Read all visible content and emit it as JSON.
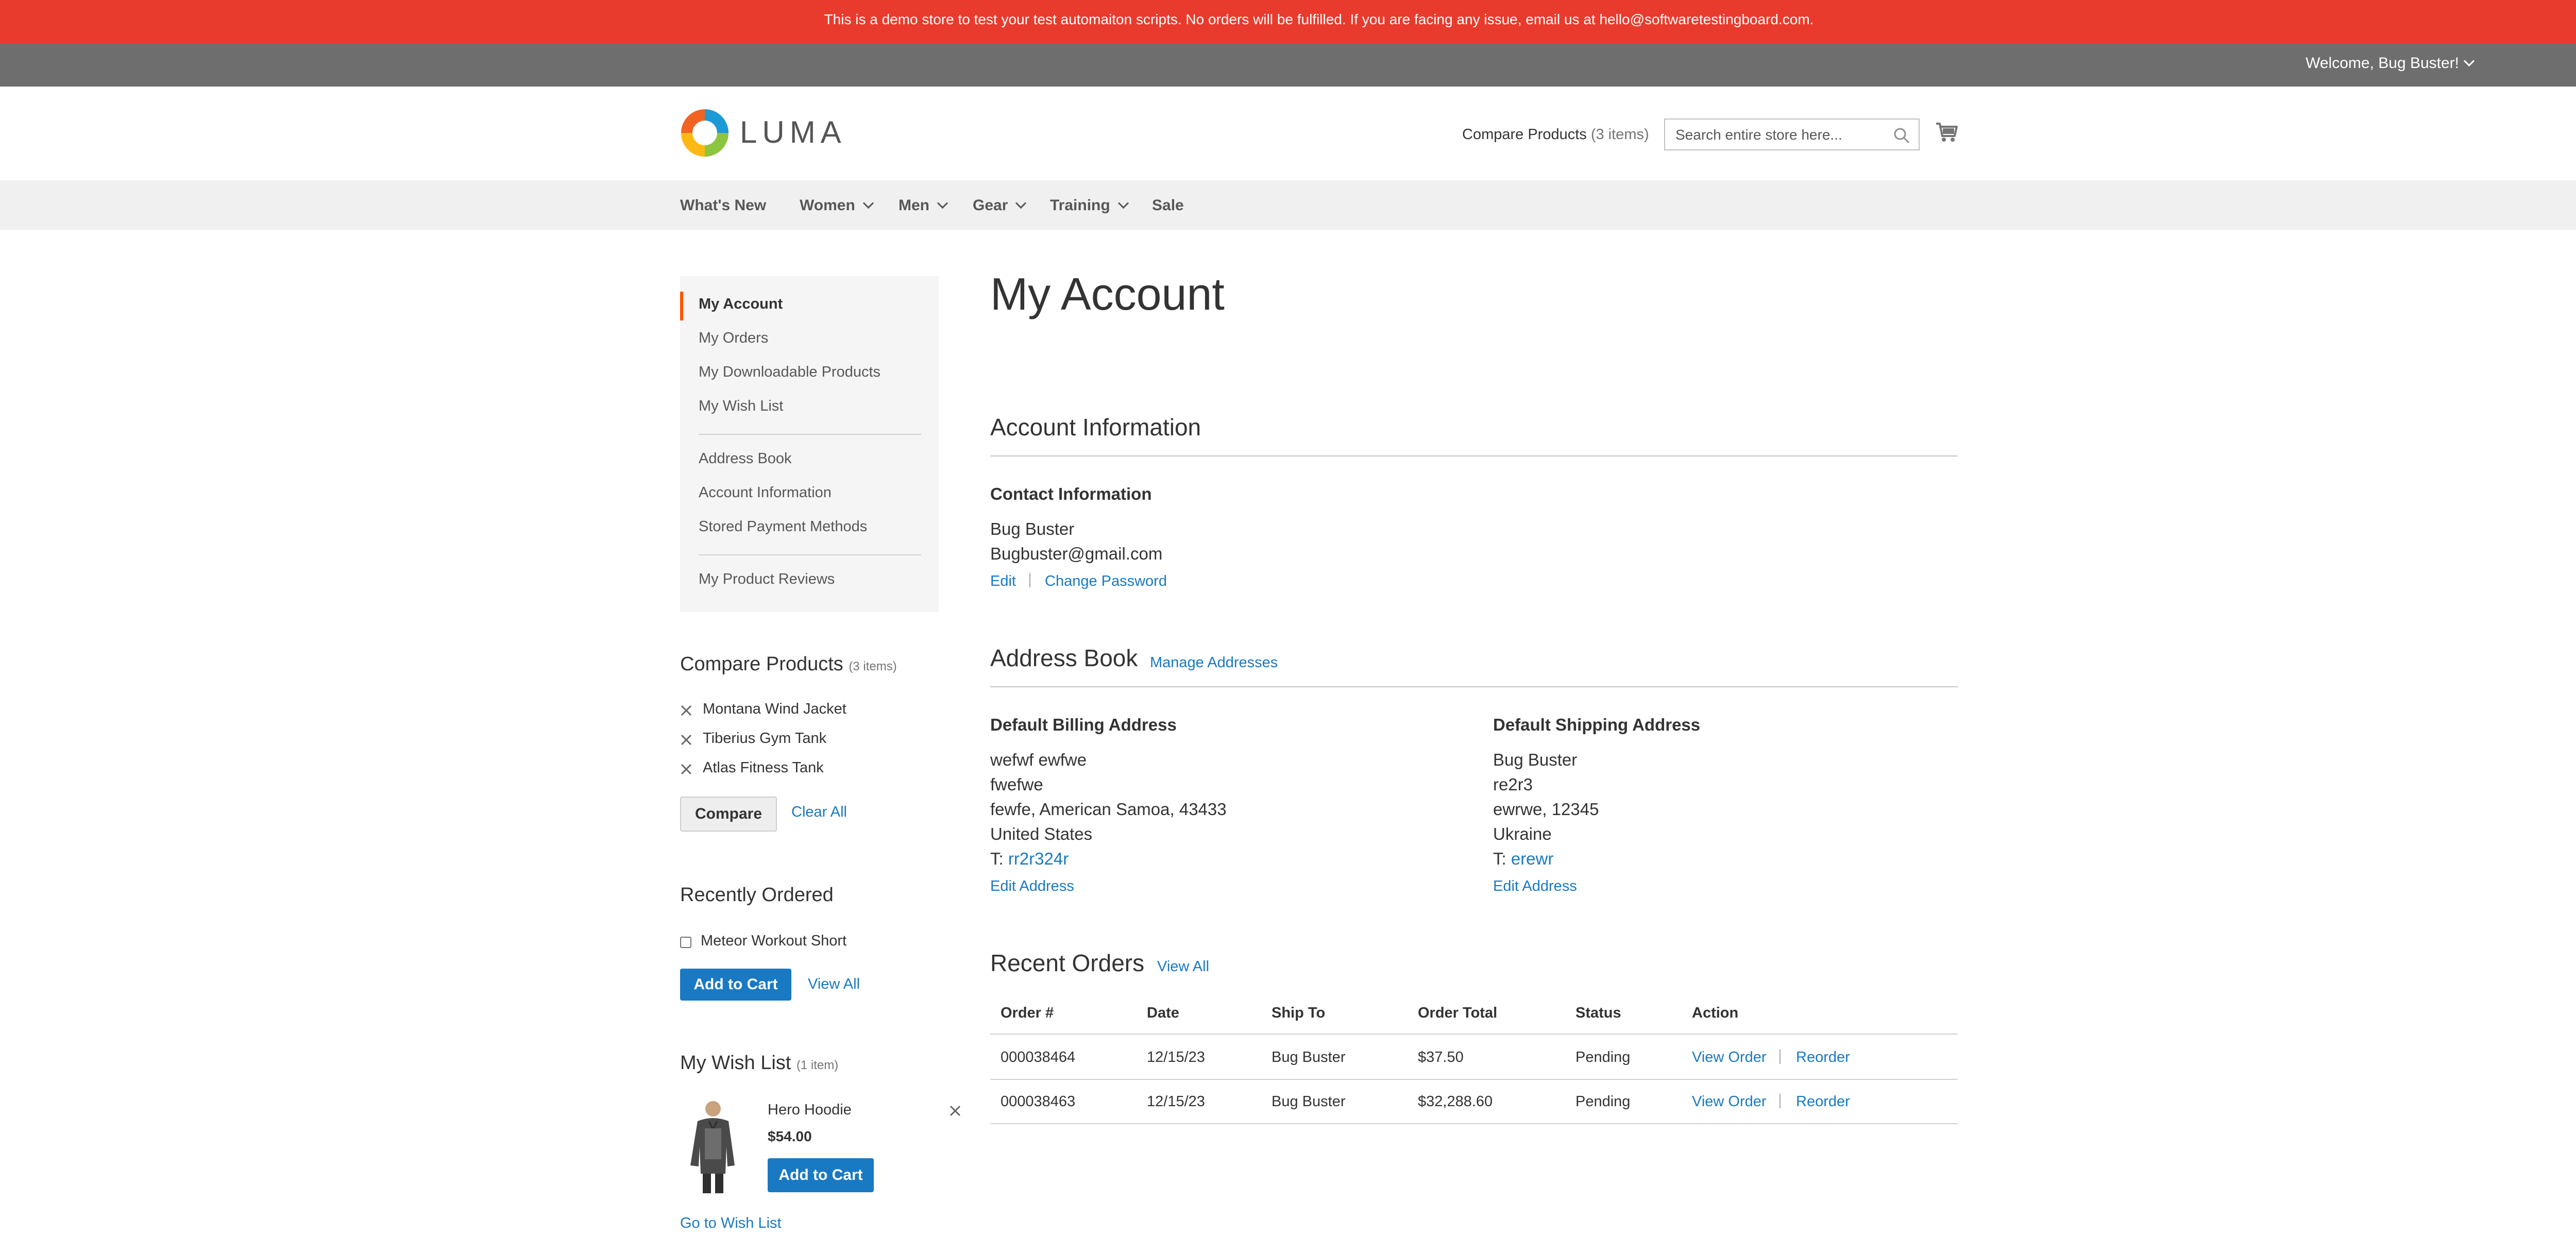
{
  "notice": "This is a demo store to test your test automaiton scripts. No orders will be fulfilled. If you are facing any issue, email us at hello@softwaretestingboard.com.",
  "header": {
    "welcome": "Welcome, Bug Buster!",
    "logo_text": "LUMA",
    "compare_label": "Compare Products",
    "compare_count": "(3 items)",
    "search_placeholder": "Search entire store here...",
    "search_icon": "search-icon",
    "cart_icon": "cart-icon"
  },
  "nav": [
    "What's New",
    "Women",
    "Men",
    "Gear",
    "Training",
    "Sale"
  ],
  "account_nav": {
    "group1": [
      "My Account",
      "My Orders",
      "My Downloadable Products",
      "My Wish List"
    ],
    "group2": [
      "Address Book",
      "Account Information",
      "Stored Payment Methods"
    ],
    "group3": [
      "My Product Reviews"
    ]
  },
  "compare_block": {
    "title": "Compare Products",
    "count": "(3 items)",
    "items": [
      "Montana Wind Jacket",
      "Tiberius Gym Tank",
      "Atlas Fitness Tank"
    ],
    "compare_button": "Compare",
    "clear_all": "Clear All"
  },
  "recently_ordered": {
    "title": "Recently Ordered",
    "items": [
      "Meteor Workout Short"
    ],
    "add_to_cart": "Add to Cart",
    "view_all": "View All"
  },
  "wishlist": {
    "title": "My Wish List",
    "count": "(1 item)",
    "product_name": "Hero Hoodie",
    "price": "$54.00",
    "add_to_cart": "Add to Cart",
    "go_to": "Go to Wish List"
  },
  "main": {
    "page_title": "My Account",
    "account_info_title": "Account Information",
    "contact_title": "Contact Information",
    "contact_name": "Bug Buster",
    "contact_email": "Bugbuster@gmail.com",
    "edit": "Edit",
    "change_password": "Change Password",
    "address_book_title": "Address Book",
    "manage_addresses": "Manage Addresses",
    "billing": {
      "title": "Default Billing Address",
      "lines": [
        "wefwf ewfwe",
        "fwefwe",
        "fewfe, American Samoa, 43433",
        "United States"
      ],
      "phone_prefix": "T:",
      "phone": "rr2r324r",
      "edit": "Edit Address"
    },
    "shipping": {
      "title": "Default Shipping Address",
      "lines": [
        "Bug Buster",
        "re2r3",
        "ewrwe, 12345",
        "Ukraine"
      ],
      "phone_prefix": "T:",
      "phone": "erewr",
      "edit": "Edit Address"
    },
    "recent_orders_title": "Recent Orders",
    "view_all": "View All",
    "orders_headers": [
      "Order #",
      "Date",
      "Ship To",
      "Order Total",
      "Status",
      "Action"
    ],
    "orders": [
      {
        "order": "000038464",
        "date": "12/15/23",
        "ship_to": "Bug Buster",
        "total": "$37.50",
        "status": "Pending",
        "view": "View Order",
        "reorder": "Reorder"
      },
      {
        "order": "000038463",
        "date": "12/15/23",
        "ship_to": "Bug Buster",
        "total": "$32,288.60",
        "status": "Pending",
        "view": "View Order",
        "reorder": "Reorder"
      }
    ]
  },
  "colors": {
    "notice_bg": "#e83b2d",
    "header_bg": "#6e6e6e",
    "link": "#1979c3",
    "accent": "#ff5501"
  }
}
